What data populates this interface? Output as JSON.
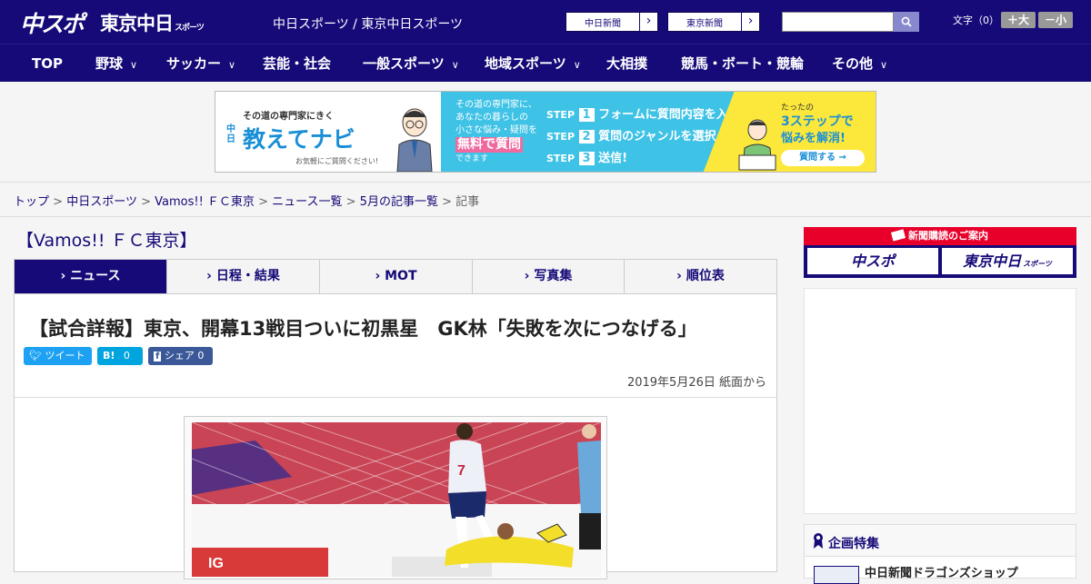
{
  "header": {
    "logo": "中スポ",
    "logo2": "東京中日",
    "logo2_sub": "スポーツ",
    "tagline": "中日スポーツ / 東京中日スポーツ",
    "paper_links": [
      "中日新聞",
      "東京新聞"
    ],
    "search_placeholder": "",
    "font_size_label": "文字（0）",
    "font_larger": "＋大",
    "font_smaller": "－小"
  },
  "nav": {
    "items": [
      {
        "label": "TOP",
        "dropdown": false
      },
      {
        "label": "野球",
        "dropdown": true
      },
      {
        "label": "サッカー",
        "dropdown": true
      },
      {
        "label": "芸能・社会",
        "dropdown": false
      },
      {
        "label": "一般スポーツ",
        "dropdown": true
      },
      {
        "label": "地域スポーツ",
        "dropdown": true
      },
      {
        "label": "大相撲",
        "dropdown": false
      },
      {
        "label": "競馬・ボート・競輪",
        "dropdown": false
      },
      {
        "label": "その他",
        "dropdown": true
      }
    ]
  },
  "ad_banner": {
    "tag": "その道の専門家にきく",
    "brand_prefix": "中日",
    "brand": "教えてナビ",
    "sub": "お気軽にご質問ください!",
    "mid_text": [
      "その道の専門家に、",
      "あなたの暮らしの",
      "小さな悩み・疑問を"
    ],
    "mid_highlight": "無料で質問",
    "mid_end": "できます",
    "steps": [
      {
        "label": "STEP",
        "num": "1",
        "text": "フォームに質問内容を入力"
      },
      {
        "label": "STEP",
        "num": "2",
        "text": "質問のジャンルを選択"
      },
      {
        "label": "STEP",
        "num": "3",
        "text": "送信!"
      }
    ],
    "right_small": "たったの",
    "right_big": "3ステップで",
    "right_mid": "悩みを解消!",
    "right_btn": "質問する →"
  },
  "breadcrumb": {
    "items": [
      "トップ",
      "中日スポーツ",
      "Vamos!! ＦＣ東京",
      "ニュース一覧",
      "5月の記事一覧"
    ],
    "current": "記事",
    "sep": ">"
  },
  "section_title": "【Vamos!! ＦＣ東京】",
  "tabs": [
    {
      "label": "ニュース",
      "active": true
    },
    {
      "label": "日程・結果",
      "active": false
    },
    {
      "label": "MOT",
      "active": false
    },
    {
      "label": "写真集",
      "active": false
    },
    {
      "label": "順位表",
      "active": false
    }
  ],
  "article": {
    "headline": "【試合詳報】東京、開幕13戦目ついに初黒星　GK林「失敗を次につなげる」",
    "share": {
      "tweet": "ツイート",
      "hatena_count": "0",
      "facebook_label": "シェア",
      "facebook_count": "0"
    },
    "date": "2019年5月26日 紙面から",
    "photo_jersey_number": "7"
  },
  "sidebar": {
    "subscription_head": "新聞購読のご案内",
    "subscription_papers": [
      "中スポ",
      "東京中日"
    ],
    "subscription_paper2_sub": "スポーツ",
    "feature_title": "企画特集",
    "feature_item": "中日新聞ドラゴンズショップ"
  },
  "colors": {
    "brand_navy": "#150a78",
    "accent_red": "#e8002b",
    "twitter": "#1da1f2",
    "hatena": "#00a4de",
    "facebook": "#3b5998"
  }
}
